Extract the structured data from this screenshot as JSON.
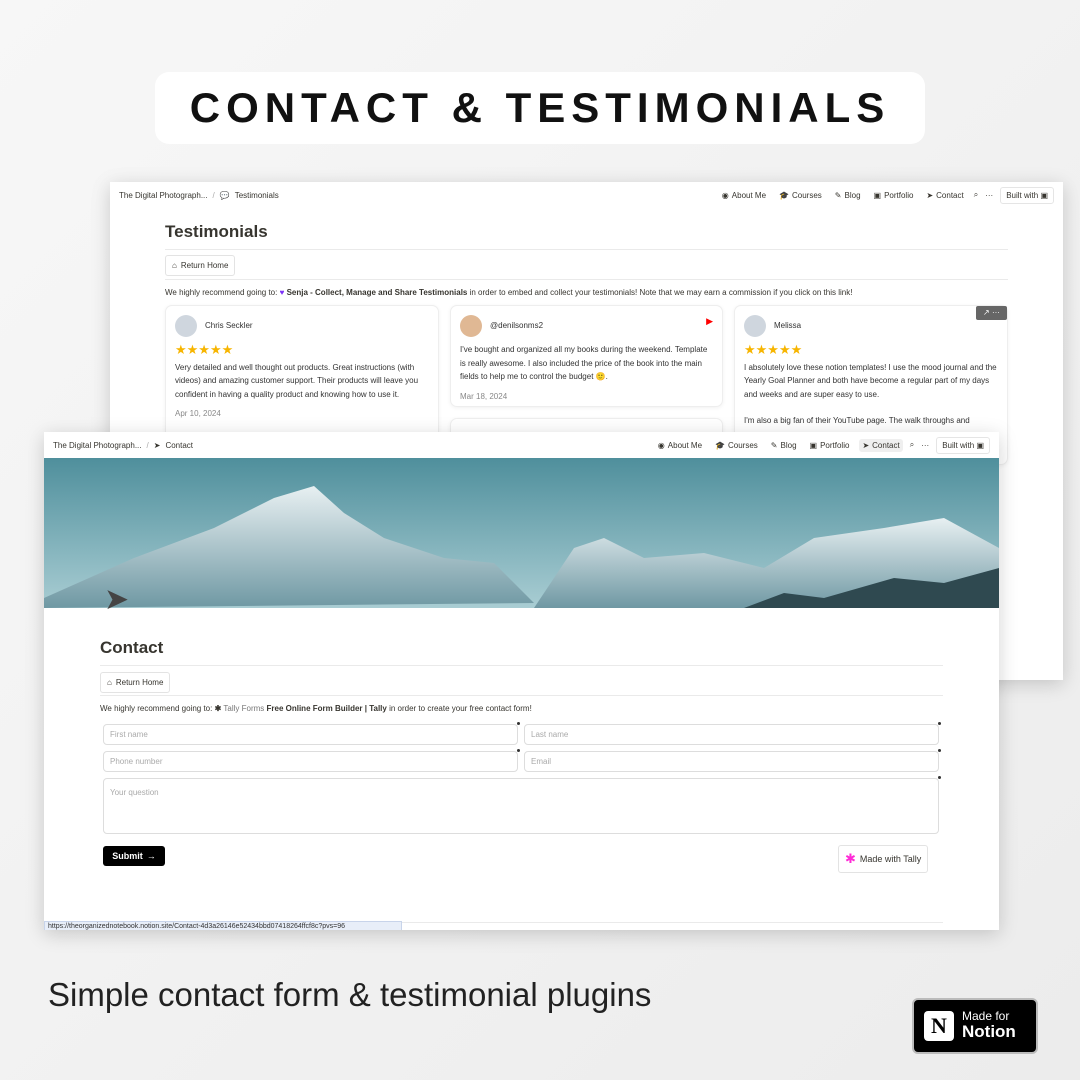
{
  "headline": "CONTACT & TESTIMONIALS",
  "caption": "Simple contact form & testimonial plugins",
  "badge": {
    "line1": "Made for",
    "line2": "Notion"
  },
  "nav": {
    "site": "The Digital Photograph...",
    "items": [
      "About Me",
      "Courses",
      "Blog",
      "Portfolio",
      "Contact"
    ],
    "built_with": "Built with"
  },
  "testimonials_page": {
    "crumb": "Testimonials",
    "title": "Testimonials",
    "return_home": "Return Home",
    "recommend": {
      "prefix": "We highly recommend going to:",
      "link": "Senja - Collect, Manage and Share Testimonials",
      "suffix": "in order to embed and collect your testimonials! Note that we may earn a commission if you click on this link!"
    },
    "cards": [
      {
        "name": "Chris Seckler",
        "rating": 5,
        "text": "Very detailed and well thought out products. Great instructions (with videos) and amazing customer support. Their products will leave you confident in having a quality product and knowing how to use it.",
        "date": "Apr 10, 2024"
      },
      {
        "name": "@denilsonms2",
        "text": "I've bought and organized all my books during the weekend. Template is really awesome. I also included the price of the book into the main fields to help me to control the budget 🙂.",
        "date": "Mar 18, 2024",
        "source": "youtube"
      },
      {
        "name": "Melissa",
        "rating": 5,
        "text": "I absolutely love these notion templates! I use the mood journal and the Yearly Goal Planner and both have become a regular part of my days and weeks and are super easy to use.",
        "text2": "I'm also a big fan of their YouTube page. The walk throughs and"
      }
    ]
  },
  "contact_page": {
    "crumb": "Contact",
    "title": "Contact",
    "return_home": "Return Home",
    "recommend": {
      "prefix": "We highly recommend going to:",
      "site": "Tally Forms",
      "link": "Free Online Form Builder | Tally",
      "suffix": "in order to create your free contact form!"
    },
    "form": {
      "first_name": "First name",
      "last_name": "Last name",
      "phone": "Phone number",
      "email": "Email",
      "question": "Your question",
      "submit": "Submit",
      "made_with": "Made with Tally"
    },
    "status_url": "https://theorganizednotebook.notion.site/Contact-4d3a26146e52434bbd07418264ffcf8c?pvs=96"
  },
  "colors": {
    "star": "#f7b500",
    "senja": "#7b2ff7",
    "tally": "#ff2bd6",
    "youtube": "#ff0000"
  }
}
